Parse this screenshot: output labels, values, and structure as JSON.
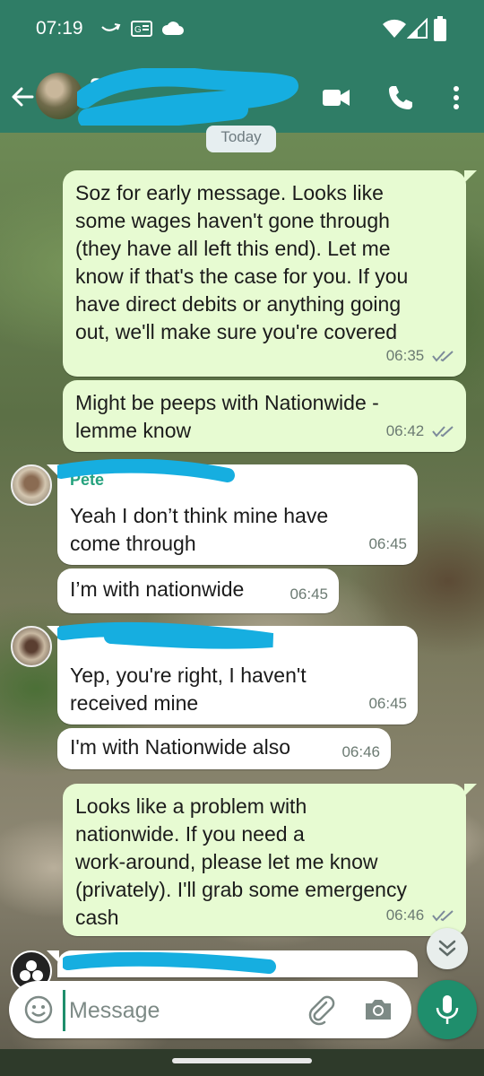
{
  "status_bar": {
    "time": "07:19"
  },
  "header": {
    "contact_name": "S",
    "contact_subtitle": "",
    "icons": [
      "back-arrow-icon",
      "video-call-icon",
      "voice-call-icon",
      "more-vert-icon"
    ],
    "color": "#2f7d66"
  },
  "chat": {
    "date_chip": "Today",
    "messages": [
      {
        "direction": "out",
        "lines": [
          "Soz for early message. Looks like",
          "some wages haven't gone through",
          "(they have all left this end). Let me",
          "know if that's the case for you. If you",
          "have direct debits or anything going",
          "out, we'll make sure you're covered"
        ],
        "time": "06:35",
        "status": "read"
      },
      {
        "direction": "out",
        "lines": [
          "Might be peeps with Nationwide -",
          "lemme know"
        ],
        "time": "06:42",
        "status": "read"
      },
      {
        "direction": "in",
        "sender_visible": "Pete",
        "lines": [
          "Yeah I don’t think mine have",
          "come through"
        ],
        "time": "06:45"
      },
      {
        "direction": "in",
        "lines": [
          "I’m with nationwide"
        ],
        "time": "06:45"
      },
      {
        "direction": "in",
        "sender_visible": "na",
        "lines": [
          "Yep, you're right, I haven't",
          "received mine"
        ],
        "time": "06:45"
      },
      {
        "direction": "in",
        "lines": [
          "I'm with Nationwide also"
        ],
        "time": "06:46"
      },
      {
        "direction": "out",
        "lines": [
          "Looks like a problem with",
          "nationwide. If you need a",
          "work-around, please let me know",
          "(privately). I'll grab some emergency",
          "cash"
        ],
        "time": "06:46",
        "status": "read"
      }
    ]
  },
  "composer": {
    "placeholder": "Message",
    "icons": [
      "emoji-icon",
      "attach-icon",
      "camera-icon",
      "mic-icon"
    ]
  },
  "colors": {
    "outgoing_bubble": "#e7fbd2",
    "incoming_bubble": "#ffffff",
    "accent": "#1f8e6c",
    "read_ticks": "#7c8a9a",
    "redaction": "#16aee0"
  }
}
